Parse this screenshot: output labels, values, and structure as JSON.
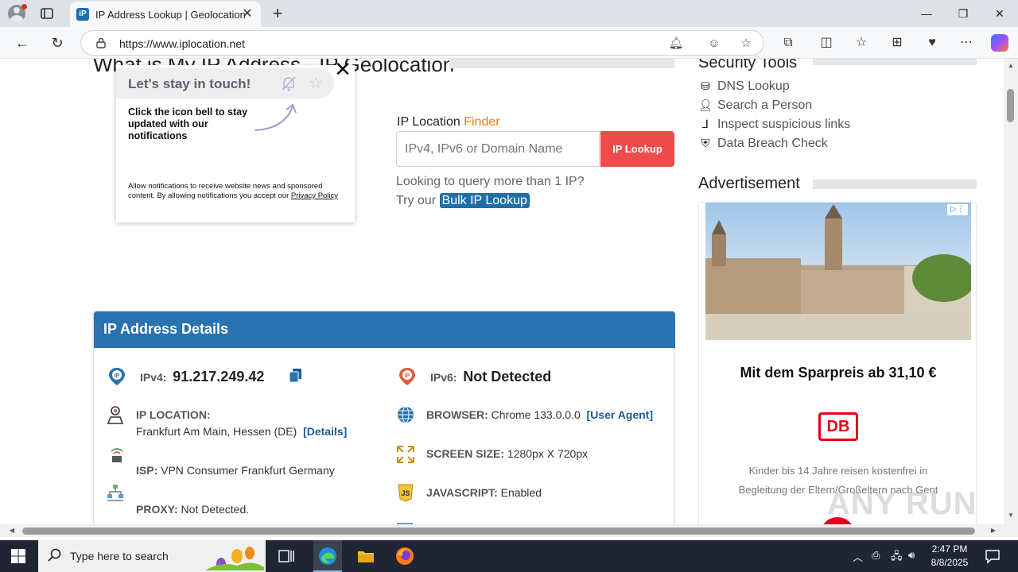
{
  "browser": {
    "tab_title": "IP Address Lookup | Geolocation",
    "url": "https://www.iplocation.net"
  },
  "page": {
    "heading": "What is My IP Address - IP Geolocation",
    "finder_label_prefix": "IP Location ",
    "finder_label_accent": "Finder",
    "search_placeholder": "IPv4, IPv6 or Domain Name",
    "lookup_button": "IP Lookup",
    "query_text": "Looking to query more than 1 IP?",
    "try_text": "Try our ",
    "bulk_link": "Bulk IP Lookup"
  },
  "security_tools": {
    "title": "Security Tools",
    "items": [
      {
        "label": "DNS Lookup",
        "icon": "dns-icon"
      },
      {
        "label": "Search a Person",
        "icon": "person-icon"
      },
      {
        "label": "Inspect suspicious links",
        "icon": "hook-icon"
      },
      {
        "label": "Data Breach Check",
        "icon": "shield-icon"
      }
    ]
  },
  "advertisement": {
    "title": "Advertisement",
    "headline": "Mit dem Sparpreis ab 31,10 €",
    "logo_text": "DB",
    "copy_line1": "Kinder bis 14 Jahre reisen kostenfrei in",
    "copy_line2": "Begleitung der Eltern/Großeltern nach Gent"
  },
  "ip_details": {
    "title": "IP Address Details",
    "ipv4_label": "IPv4:",
    "ipv4_value": "91.217.249.42",
    "ipv6_label": "IPv6:",
    "ipv6_value": "Not Detected",
    "location_label": "IP LOCATION:",
    "location_value": "Frankfurt Am Main, Hessen (DE)",
    "details_link": "[Details]",
    "browser_label": "BROWSER:",
    "browser_value": "Chrome 133.0.0.0",
    "user_agent_link": "[User Agent]",
    "isp_label": "ISP:",
    "isp_value": "VPN Consumer Frankfurt Germany",
    "screen_label": "SCREEN SIZE:",
    "screen_value": "1280px X 720px",
    "proxy_label": "PROXY:",
    "proxy_value": "Not Detected.",
    "js_label": "JAVASCRIPT:",
    "js_value": "Enabled"
  },
  "popup": {
    "title": "Let's stay in touch!",
    "body": "Click the icon bell to stay updated with our notifications",
    "fine_print": "Allow notifications to receive website news and sponsored content. By allowing notifications you accept our ",
    "privacy_link": "Privacy Policy"
  },
  "watermark": "ANY RUN",
  "taskbar": {
    "search_placeholder": "Type here to search",
    "time": "2:47 PM",
    "date": "8/8/2025"
  },
  "colors": {
    "accent_blue": "#2a72b0",
    "lookup_red": "#f04b4b",
    "finder_orange": "#f07b1a"
  }
}
